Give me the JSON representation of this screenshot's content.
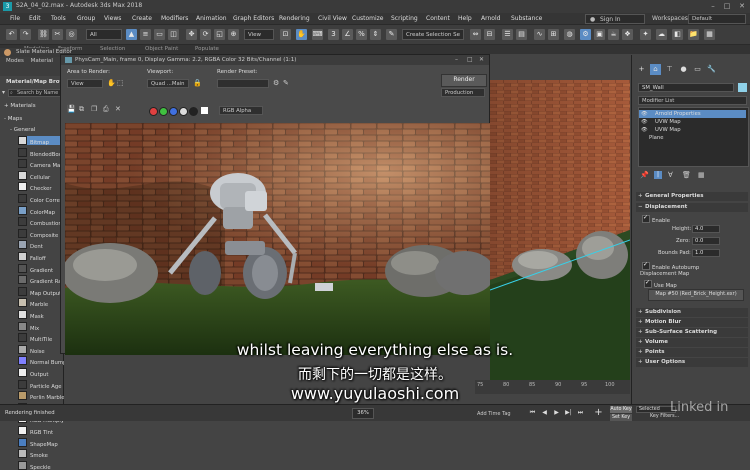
{
  "window": {
    "title": "S2A_04_02.max - Autodesk 3ds Max 2018"
  },
  "menu": {
    "items": [
      "File",
      "Edit",
      "Tools",
      "Group",
      "Views",
      "Create",
      "Modifiers",
      "Animation",
      "Graph Editors",
      "Rendering",
      "Civil View",
      "Customize",
      "Scripting",
      "Content",
      "Help",
      "Arnold",
      "Substance"
    ],
    "sign_in": "Sign In",
    "workspaces_label": "Workspaces:",
    "workspace_value": "Default"
  },
  "toolbar": {
    "filter_value": "All",
    "view_value": "View",
    "selection_set_placeholder": "Create Selection Se"
  },
  "ribbon": {
    "items": [
      "Modeling",
      "Freeform",
      "Selection",
      "Object Paint",
      "Populate"
    ]
  },
  "slate": {
    "title": "Slate Material Editor",
    "menu": [
      "Modes",
      "Material"
    ],
    "browser_title": "Material/Map Brows",
    "search_placeholder": "Search by Name",
    "section_materials": "+ Materials",
    "section_maps": "- Maps",
    "section_general": "- General",
    "maps": [
      {
        "label": "Bitmap",
        "color": "#d8d8d8"
      },
      {
        "label": "BlendedBoxM",
        "color": "#3c3c3c"
      },
      {
        "label": "Camera Map",
        "color": "#3c3c3c"
      },
      {
        "label": "Cellular",
        "color": "#d9d9d9"
      },
      {
        "label": "Checker",
        "color": "#eeeeee"
      },
      {
        "label": "Color Correct",
        "color": "#3c3c3c"
      },
      {
        "label": "ColorMap",
        "color": "#7aa0c8"
      },
      {
        "label": "Combustion",
        "color": "#3c3c3c"
      },
      {
        "label": "Composite",
        "color": "#3c3c3c"
      },
      {
        "label": "Dent",
        "color": "#9aa4b2"
      },
      {
        "label": "Falloff",
        "color": "#cfcfcf"
      },
      {
        "label": "Gradient",
        "color": "#555555"
      },
      {
        "label": "Gradient Ran",
        "color": "#6b6b6b"
      },
      {
        "label": "Map Output S",
        "color": "#3c3c3c"
      },
      {
        "label": "Marble",
        "color": "#c8c0b0"
      },
      {
        "label": "Mask",
        "color": "#e0e0e0"
      },
      {
        "label": "Mix",
        "color": "#888888"
      },
      {
        "label": "MultiTile",
        "color": "#3c3c3c"
      },
      {
        "label": "Noise",
        "color": "#aaaaaa"
      },
      {
        "label": "Normal Bump",
        "color": "#8080ff"
      },
      {
        "label": "Output",
        "color": "#eeeeee"
      },
      {
        "label": "Particle Age",
        "color": "#3c3c3c"
      },
      {
        "label": "Perlin Marble",
        "color": "#b89a6a"
      },
      {
        "label": "Raytrace",
        "color": "#cfd8e0"
      },
      {
        "label": "RGB Multiply",
        "color": "#f0f0f0"
      },
      {
        "label": "RGB Tint",
        "color": "#f0f0f0"
      },
      {
        "label": "ShapeMap",
        "color": "#4a7ec0"
      },
      {
        "label": "Smoke",
        "color": "#bbbbbb"
      },
      {
        "label": "Speckle",
        "color": "#999999"
      }
    ],
    "selected_index": 0
  },
  "render_frame": {
    "title": "PhysCam_Main, frame 0, Display Gamma: 2.2, RGBA Color 32 Bits/Channel (1:1)",
    "area_label": "Area to Render:",
    "area_value": "View",
    "viewport_label": "Viewport:",
    "viewport_value": "Quad ...Main",
    "preset_label": "Render Preset:",
    "preset_value": "",
    "render_button": "Render",
    "production_value": "Production",
    "channel_value": "RGB Alpha",
    "channel_colors": [
      "#e04040",
      "#40c040",
      "#4070e0",
      "#dddddd",
      "#222222"
    ]
  },
  "command_panel": {
    "object_name": "SM_Wall",
    "object_color": "#8fd1e8",
    "modifier_list": "Modifier List",
    "stack": [
      {
        "label": "Arnold Properties",
        "selected": true
      },
      {
        "label": "UVW Map",
        "selected": false
      },
      {
        "label": "UVW Map",
        "selected": false
      },
      {
        "label": "Plane",
        "selected": false
      }
    ],
    "rollouts": {
      "general": "General Properties",
      "displacement": "Displacement",
      "subdivision": "Subdivision",
      "motion_blur": "Motion Blur",
      "sss": "Sub-Surface Scattering",
      "volume": "Volume",
      "points": "Points",
      "user_options": "User Options"
    },
    "enable_label": "Enable",
    "height_label": "Height:",
    "height_value": "4.0",
    "zero_label": "Zero:",
    "zero_value": "0.0",
    "bounds_label": "Bounds Pad:",
    "bounds_value": "1.0",
    "autobump_label": "Enable Autobump",
    "dispmap_label": "Displacement Map",
    "usemap_label": "Use Map",
    "map_button": "Map #50 (Red_Brick_Height.exr)"
  },
  "timeline": {
    "ticks": [
      "75",
      "80",
      "85",
      "90",
      "95",
      "100"
    ],
    "add_time_tag": "Add Time Tag"
  },
  "bottom": {
    "status": "Rendering finished",
    "zoom": "36%",
    "auto_key": "Auto Key",
    "set_key": "Set Key",
    "selected": "Selected",
    "key_filters": "Key Filters..."
  },
  "subtitles": {
    "english": "whilst leaving everything else as is.",
    "chinese": "而剩下的一切都是这样。",
    "url": "www.yuyulaoshi.com"
  },
  "watermark": "Linked in"
}
